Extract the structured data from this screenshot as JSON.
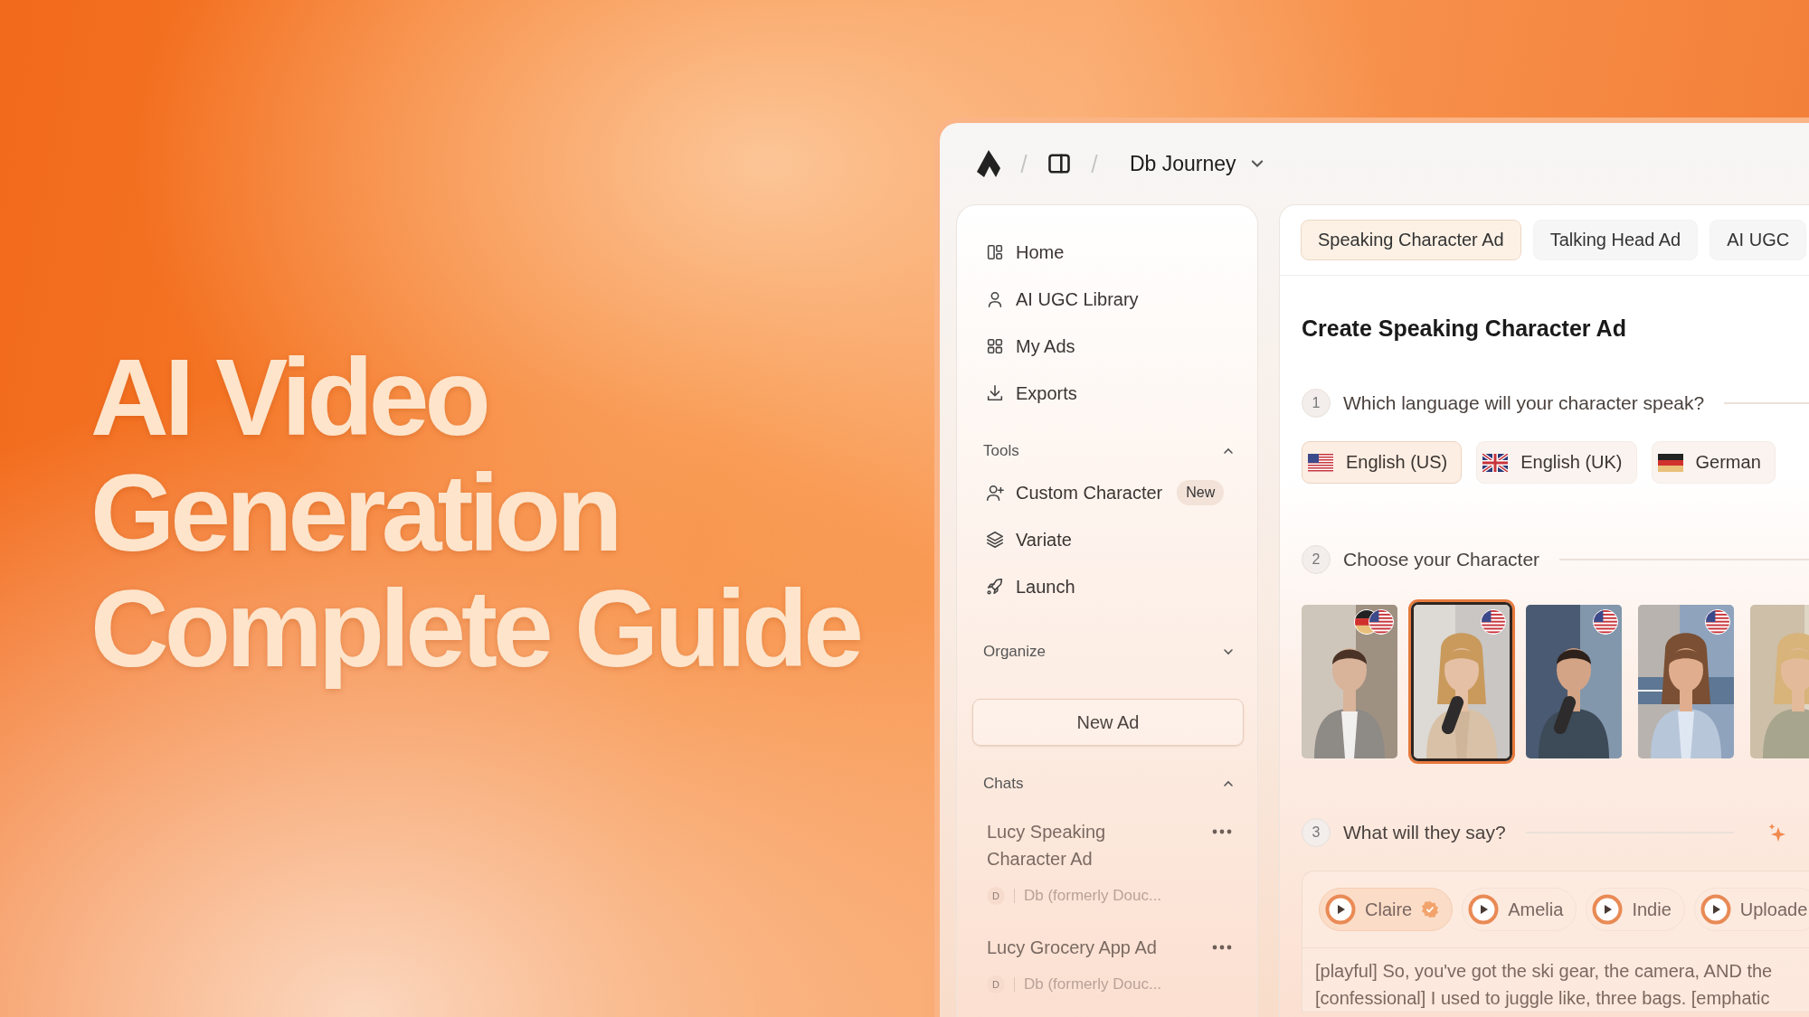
{
  "headline": [
    "AI Video",
    "Generation",
    "Complete Guide"
  ],
  "header": {
    "breadcrumb": "Db Journey"
  },
  "sidebar": {
    "nav": [
      {
        "label": "Home",
        "kind": "home"
      },
      {
        "label": "AI UGC Library",
        "kind": "person"
      },
      {
        "label": "My Ads",
        "kind": "grid"
      },
      {
        "label": "Exports",
        "kind": "download"
      }
    ],
    "sections": [
      {
        "title": "Tools",
        "expanded": true,
        "items": [
          {
            "label": "Custom Character",
            "kind": "person-plus",
            "badge": "New"
          },
          {
            "label": "Variate",
            "kind": "layers"
          },
          {
            "label": "Launch",
            "kind": "rocket"
          }
        ]
      },
      {
        "title": "Organize",
        "expanded": false
      }
    ],
    "new_button": "New Ad",
    "chats": {
      "title": "Chats",
      "expanded": true,
      "items": [
        {
          "title": "Lucy Speaking Character Ad",
          "avatar": "D",
          "workspace": "Db (formerly Douc..."
        },
        {
          "title": "Lucy Grocery App Ad",
          "avatar": "D",
          "workspace": "Db (formerly Douc..."
        }
      ]
    }
  },
  "main": {
    "tabs": [
      {
        "label": "Speaking Character Ad",
        "selected": true
      },
      {
        "label": "Talking Head Ad",
        "selected": false
      },
      {
        "label": "AI UGC",
        "selected": false
      }
    ],
    "title": "Create Speaking Character Ad",
    "language_step": {
      "number": "1",
      "question": "Which language will your character speak?",
      "languages": [
        {
          "label": "English (US)",
          "kind": "us",
          "selected": true
        },
        {
          "label": "English (UK)",
          "kind": "uk",
          "selected": false
        },
        {
          "label": "German",
          "kind": "de",
          "selected": false
        }
      ]
    },
    "character_step": {
      "number": "2",
      "question": "Choose your Character",
      "characters": [
        {
          "kind": "picture",
          "badges": [
            {
              "kind": "de"
            },
            {
              "kind": "us"
            }
          ],
          "selected": false
        },
        {
          "kind": "picture",
          "badges": [
            {
              "kind": "us"
            }
          ],
          "selected": true
        },
        {
          "kind": "picture",
          "badges": [
            {
              "kind": "us"
            }
          ],
          "selected": false
        },
        {
          "kind": "picture",
          "badges": [
            {
              "kind": "us"
            }
          ],
          "selected": false
        },
        {
          "kind": "picture",
          "selected": false
        }
      ]
    },
    "script_step": {
      "number": "3",
      "question": "What will they say?",
      "voices": [
        {
          "name": "Claire",
          "selected": true,
          "verified": true
        },
        {
          "name": "Amelia",
          "selected": false,
          "verified": false
        },
        {
          "name": "Indie",
          "selected": false,
          "verified": false
        },
        {
          "name": "Uploade",
          "selected": false,
          "verified": false
        }
      ],
      "script": [
        "[playful] So, you've got the ski gear, the camera, AND the",
        "[confessional] I used to juggle like, three bags. [emphatic"
      ]
    }
  }
}
